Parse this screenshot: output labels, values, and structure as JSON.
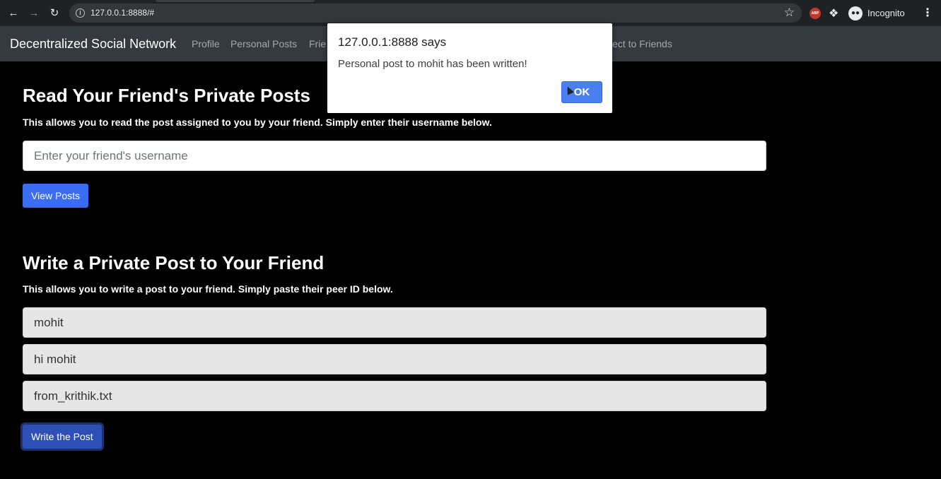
{
  "browser": {
    "url": "127.0.0.1:8888/#",
    "incognito_label": "Incognito",
    "icons": {
      "back": "arrow-left-icon",
      "forward": "arrow-right-icon",
      "reload": "reload-icon",
      "info": "info-icon",
      "bookmark": "star-icon",
      "adblock": "abp-icon",
      "extensions": "puzzle-icon",
      "menu": "more-vertical-icon"
    },
    "adblock_label": "ABP"
  },
  "navbar": {
    "brand": "Decentralized Social Network",
    "links": [
      "Profile",
      "Personal Posts",
      "Frie",
      "ect to Friends"
    ]
  },
  "read_section": {
    "title": "Read Your Friend's Private Posts",
    "description": "This allows you to read the post assigned to you by your friend. Simply enter their username below.",
    "username_placeholder": "Enter your friend's username",
    "button_label": "View Posts"
  },
  "write_section": {
    "title": "Write a Private Post to Your Friend",
    "description": "This allows you to write a post to your friend. Simply paste their peer ID below.",
    "recipient_value": "mohit",
    "message_value": "hi mohit",
    "filename_value": "from_krithik.txt",
    "button_label": "Write the Post"
  },
  "dialog": {
    "title": "127.0.0.1:8888 says",
    "message": "Personal post to mohit has been written!",
    "ok_label": "OK"
  },
  "colors": {
    "navbar_bg": "#343a40",
    "button_primary": "#3b6df2",
    "dialog_ok": "#4a7ff2"
  }
}
